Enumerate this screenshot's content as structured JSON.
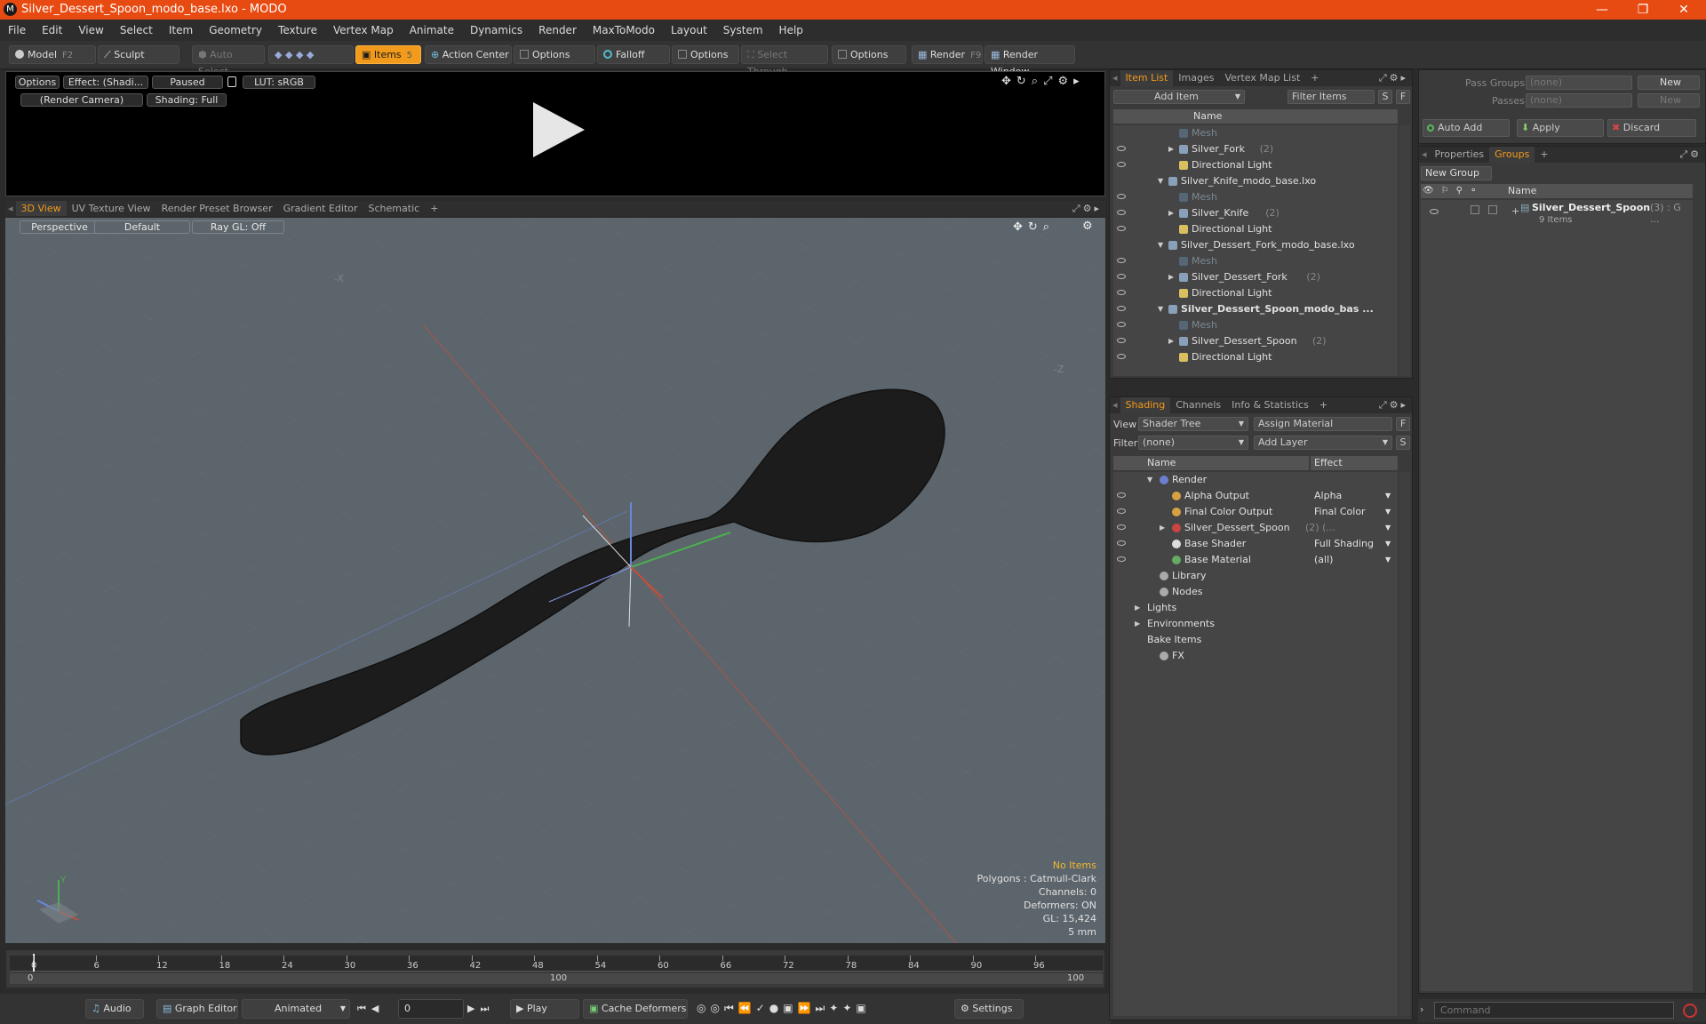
{
  "window": {
    "title": "Silver_Dessert_Spoon_modo_base.lxo - MODO",
    "logo": "M",
    "minimize": "—",
    "maximize": "❐",
    "close": "✕"
  },
  "menu": [
    "File",
    "Edit",
    "View",
    "Select",
    "Item",
    "Geometry",
    "Texture",
    "Vertex Map",
    "Animate",
    "Dynamics",
    "Render",
    "MaxToModo",
    "Layout",
    "System",
    "Help"
  ],
  "toolbar": {
    "model": "Model",
    "model_key": "F2",
    "sculpt": "Sculpt",
    "auto_select": "Auto Select",
    "items": "Items",
    "items_key": "5",
    "action_center": "Action Center",
    "options1": "Options",
    "falloff": "Falloff",
    "options2": "Options",
    "select_through": "Select Through",
    "options3": "Options",
    "render": "Render",
    "render_key": "F9",
    "render_window": "Render Window"
  },
  "preview": {
    "options": "Options",
    "effect": "Effect: (Shadi...",
    "paused": "Paused",
    "lut": "LUT: sRGB",
    "camera": "(Render Camera)",
    "shading": "Shading: Full",
    "play_icon": "play-icon"
  },
  "viewport_tabs": [
    "3D View",
    "UV Texture View",
    "Render Preset Browser",
    "Gradient Editor",
    "Schematic",
    "+"
  ],
  "viewport": {
    "perspective": "Perspective",
    "default": "Default",
    "raygl": "Ray GL: Off",
    "info": {
      "no_items": "No Items",
      "polygons": "Polygons : Catmull-Clark",
      "channels": "Channels: 0",
      "deformers": "Deformers: ON",
      "gl": "GL: 15,424",
      "scale": "5 mm"
    },
    "colors": {
      "bg": "#5c656b",
      "mesh": "#1c1c1c",
      "axis_red": "#c0503c",
      "axis_green": "#4caf50",
      "axis_blue": "#6688dd"
    }
  },
  "timeline": {
    "ticks": [
      "0",
      "6",
      "12",
      "18",
      "24",
      "30",
      "36",
      "42",
      "48",
      "54",
      "60",
      "66",
      "72",
      "78",
      "84",
      "90",
      "96"
    ],
    "sub": [
      "0",
      "100",
      "100"
    ]
  },
  "bottombar": {
    "audio": "Audio",
    "graph_editor": "Graph Editor",
    "animated": "Animated",
    "frame": "0",
    "play": "Play",
    "cache": "Cache Deformers",
    "settings": "Settings"
  },
  "item_list": {
    "tabs": [
      "Item List",
      "Images",
      "Vertex Map List",
      "+"
    ],
    "add_item": "Add Item",
    "filter_items": "Filter Items",
    "s": "S",
    "f": "F",
    "col_name": "Name",
    "rows": [
      {
        "label": "Mesh",
        "indent": 3,
        "dim": true,
        "eye": false
      },
      {
        "label": "Silver_Fork",
        "count": "(2)",
        "indent": 3,
        "arrow": "▶",
        "eye": true
      },
      {
        "label": "Directional Light",
        "indent": 3,
        "eye": true
      },
      {
        "label": "Silver_Knife_modo_base.lxo",
        "indent": 2,
        "arrow": "▼",
        "eye": false
      },
      {
        "label": "Mesh",
        "indent": 3,
        "dim": true,
        "eye": true
      },
      {
        "label": "Silver_Knife",
        "count": "(2)",
        "indent": 3,
        "arrow": "▶",
        "eye": true
      },
      {
        "label": "Directional Light",
        "indent": 3,
        "eye": true
      },
      {
        "label": "Silver_Dessert_Fork_modo_base.lxo",
        "indent": 2,
        "arrow": "▼",
        "eye": false
      },
      {
        "label": "Mesh",
        "indent": 3,
        "dim": true,
        "eye": true
      },
      {
        "label": "Silver_Dessert_Fork",
        "count": "(2)",
        "indent": 3,
        "arrow": "▶",
        "eye": true
      },
      {
        "label": "Directional Light",
        "indent": 3,
        "eye": true
      },
      {
        "label": "Silver_Dessert_Spoon_modo_bas ...",
        "indent": 2,
        "arrow": "▼",
        "bold": true,
        "eye": true
      },
      {
        "label": "Mesh",
        "indent": 3,
        "dim": true,
        "eye": true
      },
      {
        "label": "Silver_Dessert_Spoon",
        "count": "(2)",
        "indent": 3,
        "arrow": "▶",
        "eye": true
      },
      {
        "label": "Directional Light",
        "indent": 3,
        "eye": true
      }
    ]
  },
  "shading": {
    "tabs": [
      "Shading",
      "Channels",
      "Info & Statistics",
      "+"
    ],
    "view_label": "View",
    "view_value": "Shader Tree",
    "assign_material": "Assign Material",
    "filter_label": "Filter",
    "filter_value": "(none)",
    "add_layer": "Add Layer",
    "f": "F",
    "s": "S",
    "col_name": "Name",
    "col_effect": "Effect",
    "rows": [
      {
        "label": "Render",
        "effect": "",
        "indent": 1,
        "arrow": "▼",
        "icon": "#6a7fd0",
        "eye": false
      },
      {
        "label": "Alpha Output",
        "effect": "Alpha",
        "indent": 2,
        "icon": "#d8a040",
        "eye": true
      },
      {
        "label": "Final Color Output",
        "effect": "Final Color",
        "indent": 2,
        "icon": "#d8a040",
        "eye": true
      },
      {
        "label": "Silver_Dessert_Spoon",
        "extra": "(2) (...",
        "effect": "",
        "indent": 2,
        "arrow": "▶",
        "icon": "#cc4444",
        "eye": true
      },
      {
        "label": "Base Shader",
        "effect": "Full Shading",
        "indent": 2,
        "icon": "#dddddd",
        "eye": true
      },
      {
        "label": "Base Material",
        "effect": "(all)",
        "indent": 2,
        "icon": "#66aa66",
        "eye": true
      },
      {
        "label": "Library",
        "effect": "",
        "indent": 1,
        "icon": "#aaaaaa",
        "eye": false
      },
      {
        "label": "Nodes",
        "effect": "",
        "indent": 1,
        "icon": "#aaaaaa",
        "eye": false
      },
      {
        "label": "Lights",
        "effect": "",
        "indent": 0,
        "arrow": "▶",
        "eye": false
      },
      {
        "label": "Environments",
        "effect": "",
        "indent": 0,
        "arrow": "▶",
        "eye": false
      },
      {
        "label": "Bake Items",
        "effect": "",
        "indent": 0,
        "eye": false
      },
      {
        "label": "FX",
        "effect": "",
        "indent": 1,
        "icon": "#aaaaaa",
        "eye": false
      }
    ]
  },
  "passes": {
    "pass_groups_label": "Pass Groups",
    "pass_groups_value": "(none)",
    "new1": "New",
    "passes_label": "Passes",
    "passes_value": "(none)",
    "new2": "New",
    "auto_add": "Auto Add",
    "apply": "Apply",
    "discard": "Discard"
  },
  "groups": {
    "tabs": [
      "Properties",
      "Groups",
      "+"
    ],
    "new_group": "New Group",
    "col_name": "Name",
    "item_name": "Silver_Dessert_Spoon",
    "item_extra": "(3) : G ...",
    "item_count": "9 Items"
  },
  "command": {
    "placeholder": "Command"
  }
}
